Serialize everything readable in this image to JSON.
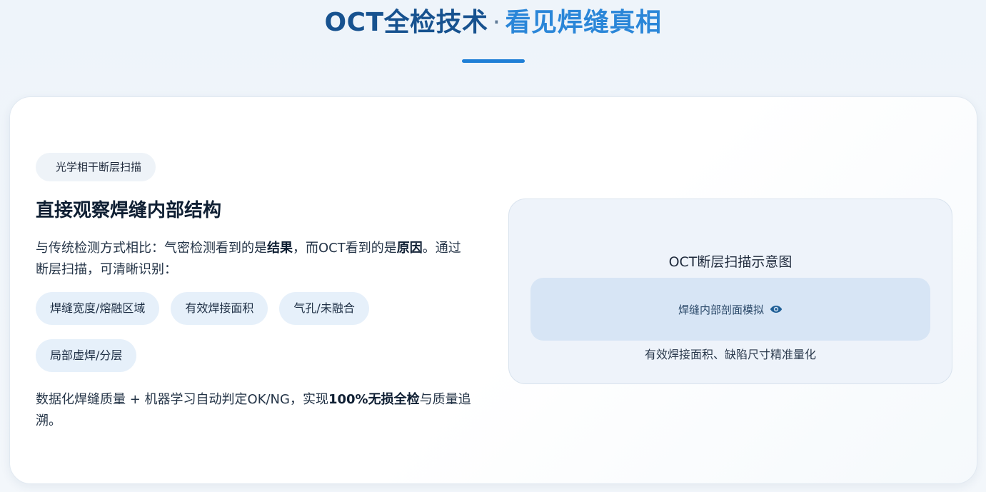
{
  "header": {
    "title_a": "OCT全检技术",
    "title_sep": "·",
    "title_b": "看见焊缝真相"
  },
  "content": {
    "tag": "光学相干断层扫描",
    "title": "直接观察焊缝内部结构",
    "desc_1": "与传统检测方式相比：气密检测看到的是",
    "desc_bold_1": "结果",
    "desc_2": "，而OCT看到的是",
    "desc_bold_2": "原因",
    "desc_3": "。通过断层扫描，可清晰识别：",
    "chips": [
      "焊缝宽度/熔融区域",
      "有效焊接面积",
      "气孔/未融合",
      "局部虚焊/分层"
    ],
    "summary_1": "数据化焊缝质量 + 机器学习自动判定OK/NG，实现",
    "summary_bold": "100%无损全检",
    "summary_2": "与质量追溯。"
  },
  "diagram": {
    "title": "OCT断层扫描示意图",
    "scan_label": "焊缝内部剖面模拟",
    "scan_icon": "eye-icon",
    "caption": "有效焊接面积、缺陷尺寸精准量化"
  },
  "colors": {
    "accent": "#1f7fd6",
    "title_dark": "#17528f",
    "title_light": "#2a86d8",
    "chip_bg": "#e6f0fa"
  }
}
